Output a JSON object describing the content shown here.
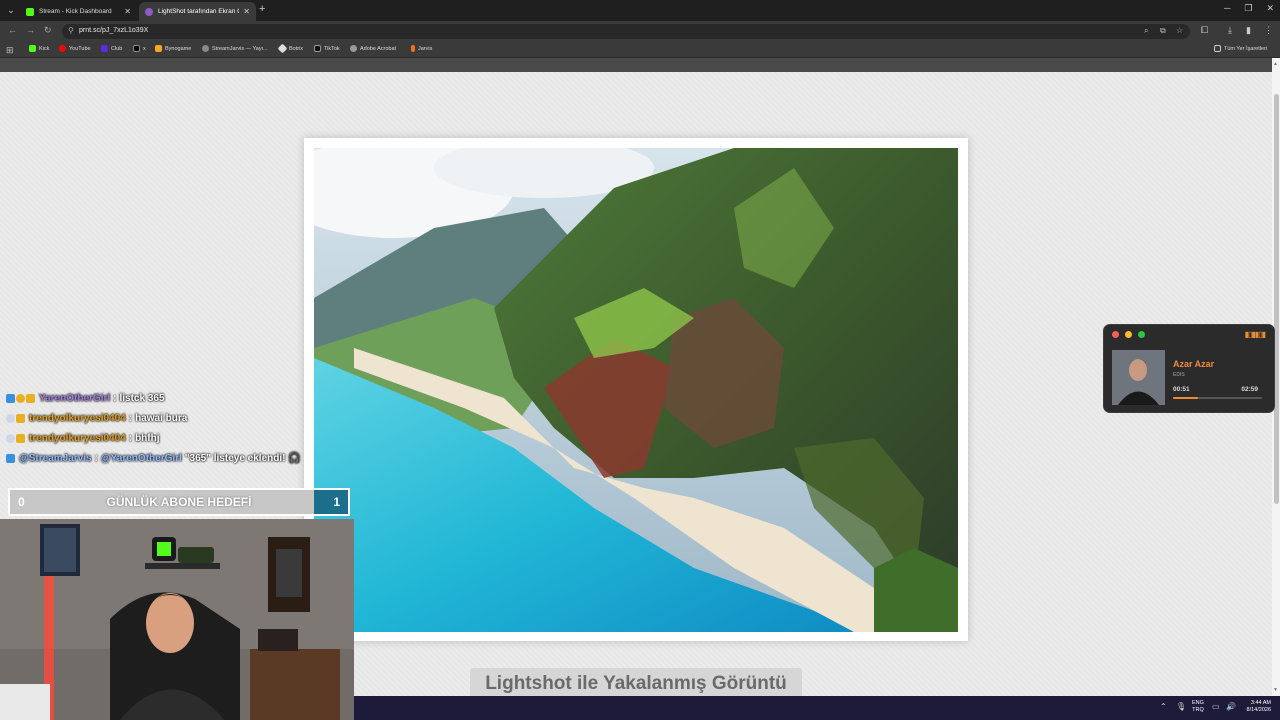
{
  "browser": {
    "tabs": [
      {
        "title": "Stream - Kick Dashboard",
        "active": false
      },
      {
        "title": "LightShot tarafından Ekran Gör",
        "active": true
      }
    ],
    "address": "prnt.sc/pJ_7xzL1o39X",
    "bookmarks": [
      {
        "label": "Kick",
        "color": "#53fc18"
      },
      {
        "label": "YouTube",
        "color": "#ff0000"
      },
      {
        "label": "Club",
        "color": "#5b2be0"
      },
      {
        "label": "x",
        "color": "#000000"
      },
      {
        "label": "Bynogame",
        "color": "#f5a623"
      },
      {
        "label": "StreamJarvis — Yayı...",
        "color": "#888888"
      },
      {
        "label": "Botrix",
        "color": "#dddddd"
      },
      {
        "label": "TikTok",
        "color": "#111111"
      },
      {
        "label": "Adobe Acrobat",
        "color": "#999999"
      },
      {
        "label": "Jarvis",
        "color": "#f07020"
      }
    ],
    "all_bookmarks_label": "Tüm Yer İşaretleri"
  },
  "page": {
    "caption": "Lightshot ile Yakalanmış Görüntü"
  },
  "chat": [
    {
      "user": "YarenOtherGirl",
      "user_color": "#9d7fe0",
      "text": "listck 365",
      "badges": [
        "#3b8fe0",
        "#e8b020",
        "#e8b020"
      ]
    },
    {
      "user": "trendyolkuryesi0404",
      "user_color": "#e0a020",
      "text": "hawai bura",
      "badges": [
        "#cfd6e8",
        "#e8b020"
      ]
    },
    {
      "user": "trendyolkuryesi0404",
      "user_color": "#e0a020",
      "text": "bhfhj",
      "badges": [
        "#cfd6e8",
        "#e8b020"
      ]
    },
    {
      "user": "@StreamJarvis",
      "user_color": "#8fb8ff",
      "mention": "@YarenOtherGirl",
      "mention_color": "#8fb8ff",
      "text": "\"365\" listeye eklendi! 🎧",
      "badges": [
        "#3b8fe0"
      ]
    }
  ],
  "goal": {
    "label": "GÜNLÜK ABONE HEDEFİ",
    "current": "0",
    "target": "1"
  },
  "player": {
    "song": "Azar Azar",
    "artist": "EDIS",
    "elapsed": "00:51",
    "duration": "02:59",
    "progress": 0.28,
    "accent": "#e98c36"
  },
  "taskbar": {
    "lang_top": "ENG",
    "lang_bottom": "TRQ",
    "time": "3:44 AM",
    "date": "8/14/2026"
  }
}
